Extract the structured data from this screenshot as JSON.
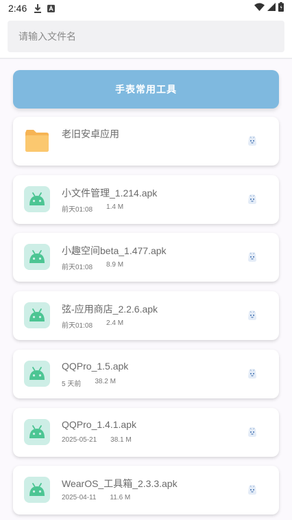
{
  "status_bar": {
    "time": "2:46",
    "left_icons": [
      "download-icon",
      "app-notification-icon"
    ],
    "right_icons": [
      "wifi-icon",
      "signal-icon",
      "battery-icon"
    ]
  },
  "search": {
    "placeholder": "请输入文件名",
    "value": ""
  },
  "header_button": {
    "label": "手表常用工具"
  },
  "colors": {
    "accent": "#7fb9df",
    "apk_icon_bg": "#cdeee6",
    "android_green": "#4cc593",
    "folder_orange": "#f9c16b"
  },
  "files": [
    {
      "name": "老旧安卓应用",
      "type": "folder",
      "icon": "folder-icon",
      "date": "",
      "size": ""
    },
    {
      "name": "小文件管理_1.214.apk",
      "type": "apk",
      "icon": "android-icon",
      "date": "前天01:08",
      "size": "1.4 M"
    },
    {
      "name": "小趣空间beta_1.477.apk",
      "type": "apk",
      "icon": "android-icon",
      "date": "前天01:08",
      "size": "8.9 M"
    },
    {
      "name": "弦-应用商店_2.2.6.apk",
      "type": "apk",
      "icon": "android-icon",
      "date": "前天01:08",
      "size": "2.4 M"
    },
    {
      "name": "QQPro_1.5.apk",
      "type": "apk",
      "icon": "android-icon",
      "date": "5 天前",
      "size": "38.2 M"
    },
    {
      "name": "QQPro_1.4.1.apk",
      "type": "apk",
      "icon": "android-icon",
      "date": "2025-05-21",
      "size": "38.1 M"
    },
    {
      "name": "WearOS_工具箱_2.3.3.apk",
      "type": "apk",
      "icon": "android-icon",
      "date": "2025-04-11",
      "size": "11.6 M"
    }
  ],
  "file_action_icon": "mascot-icon"
}
